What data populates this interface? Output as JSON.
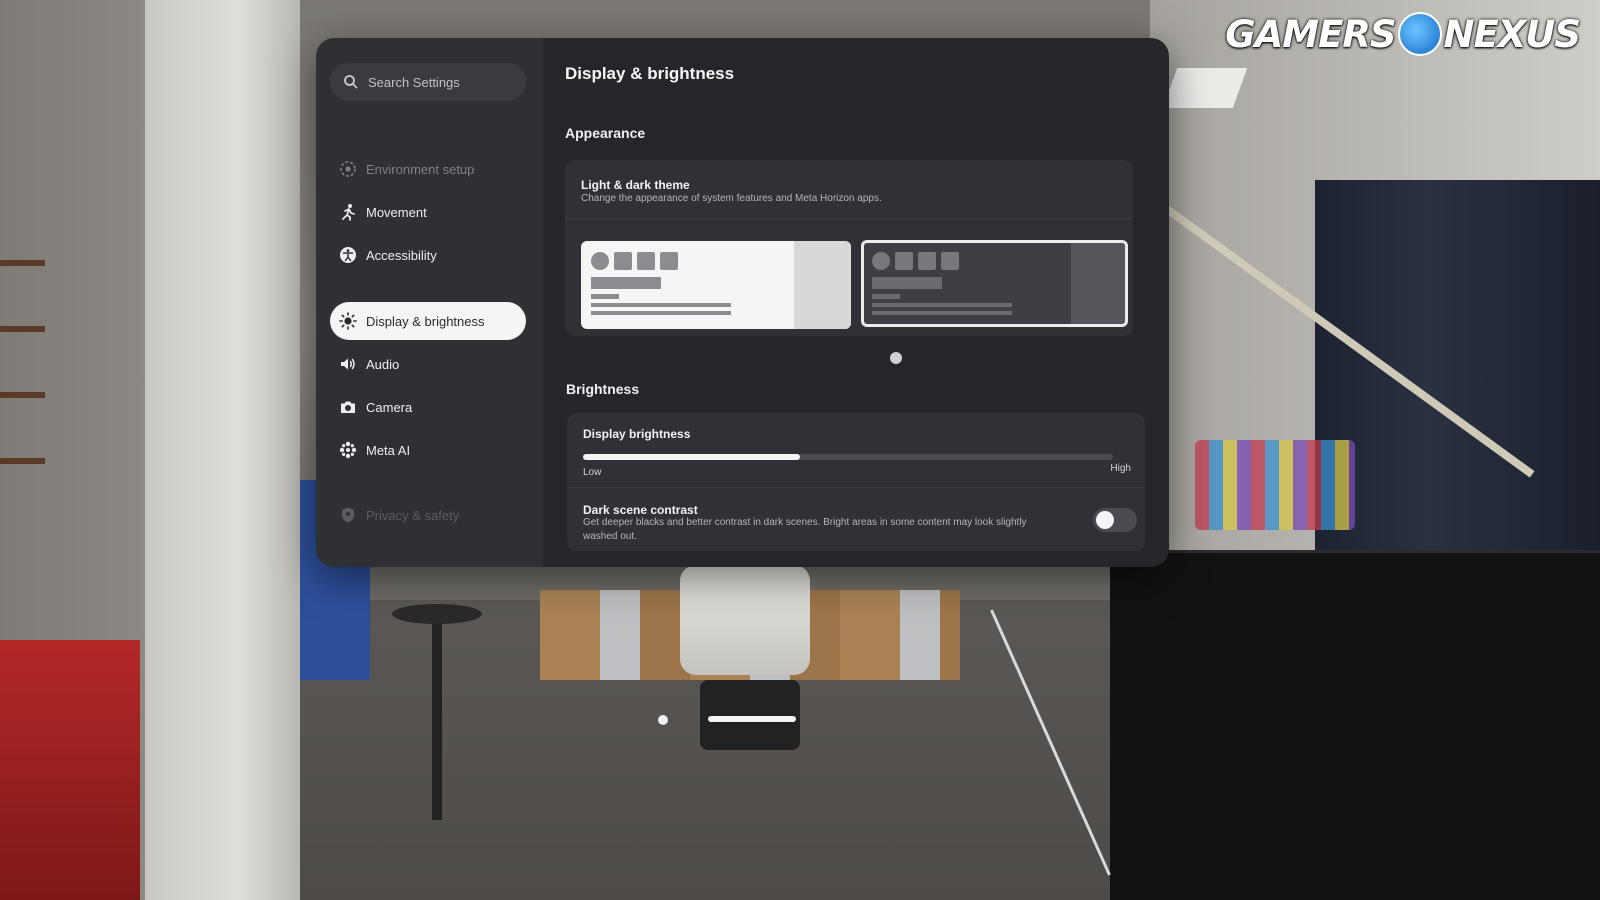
{
  "watermark": {
    "left": "GAMERS",
    "right": "NEXUS"
  },
  "search": {
    "placeholder": "Search Settings"
  },
  "sidebar": {
    "items": [
      {
        "label": "Environment setup",
        "icon": "environment-icon",
        "state": "faded"
      },
      {
        "label": "Movement",
        "icon": "movement-icon",
        "state": "normal"
      },
      {
        "label": "Accessibility",
        "icon": "accessibility-icon",
        "state": "normal"
      },
      {
        "label": "Display & brightness",
        "icon": "sun-icon",
        "state": "active"
      },
      {
        "label": "Audio",
        "icon": "speaker-icon",
        "state": "normal"
      },
      {
        "label": "Camera",
        "icon": "camera-icon",
        "state": "normal"
      },
      {
        "label": "Meta AI",
        "icon": "meta-ai-icon",
        "state": "normal"
      },
      {
        "label": "Privacy & safety",
        "icon": "shield-icon",
        "state": "faded"
      }
    ]
  },
  "main": {
    "title": "Display & brightness",
    "appearance": {
      "heading": "Appearance",
      "theme_title": "Light & dark theme",
      "theme_desc": "Change the appearance of system features and Meta Horizon apps.",
      "options": [
        "light",
        "dark"
      ],
      "selected": "dark"
    },
    "brightness": {
      "heading": "Brightness",
      "display_title": "Display brightness",
      "low_label": "Low",
      "high_label": "High",
      "level": 0.41,
      "contrast_title": "Dark scene contrast",
      "contrast_desc": "Get deeper blacks and better contrast in dark scenes. Bright areas in some content may look slightly washed out.",
      "contrast_enabled": false
    }
  },
  "colors": {
    "panel_sidebar": "#2f3034",
    "panel_content": "#25262a",
    "active_item_bg": "#f4f5f7",
    "card_bg": "#303136"
  }
}
